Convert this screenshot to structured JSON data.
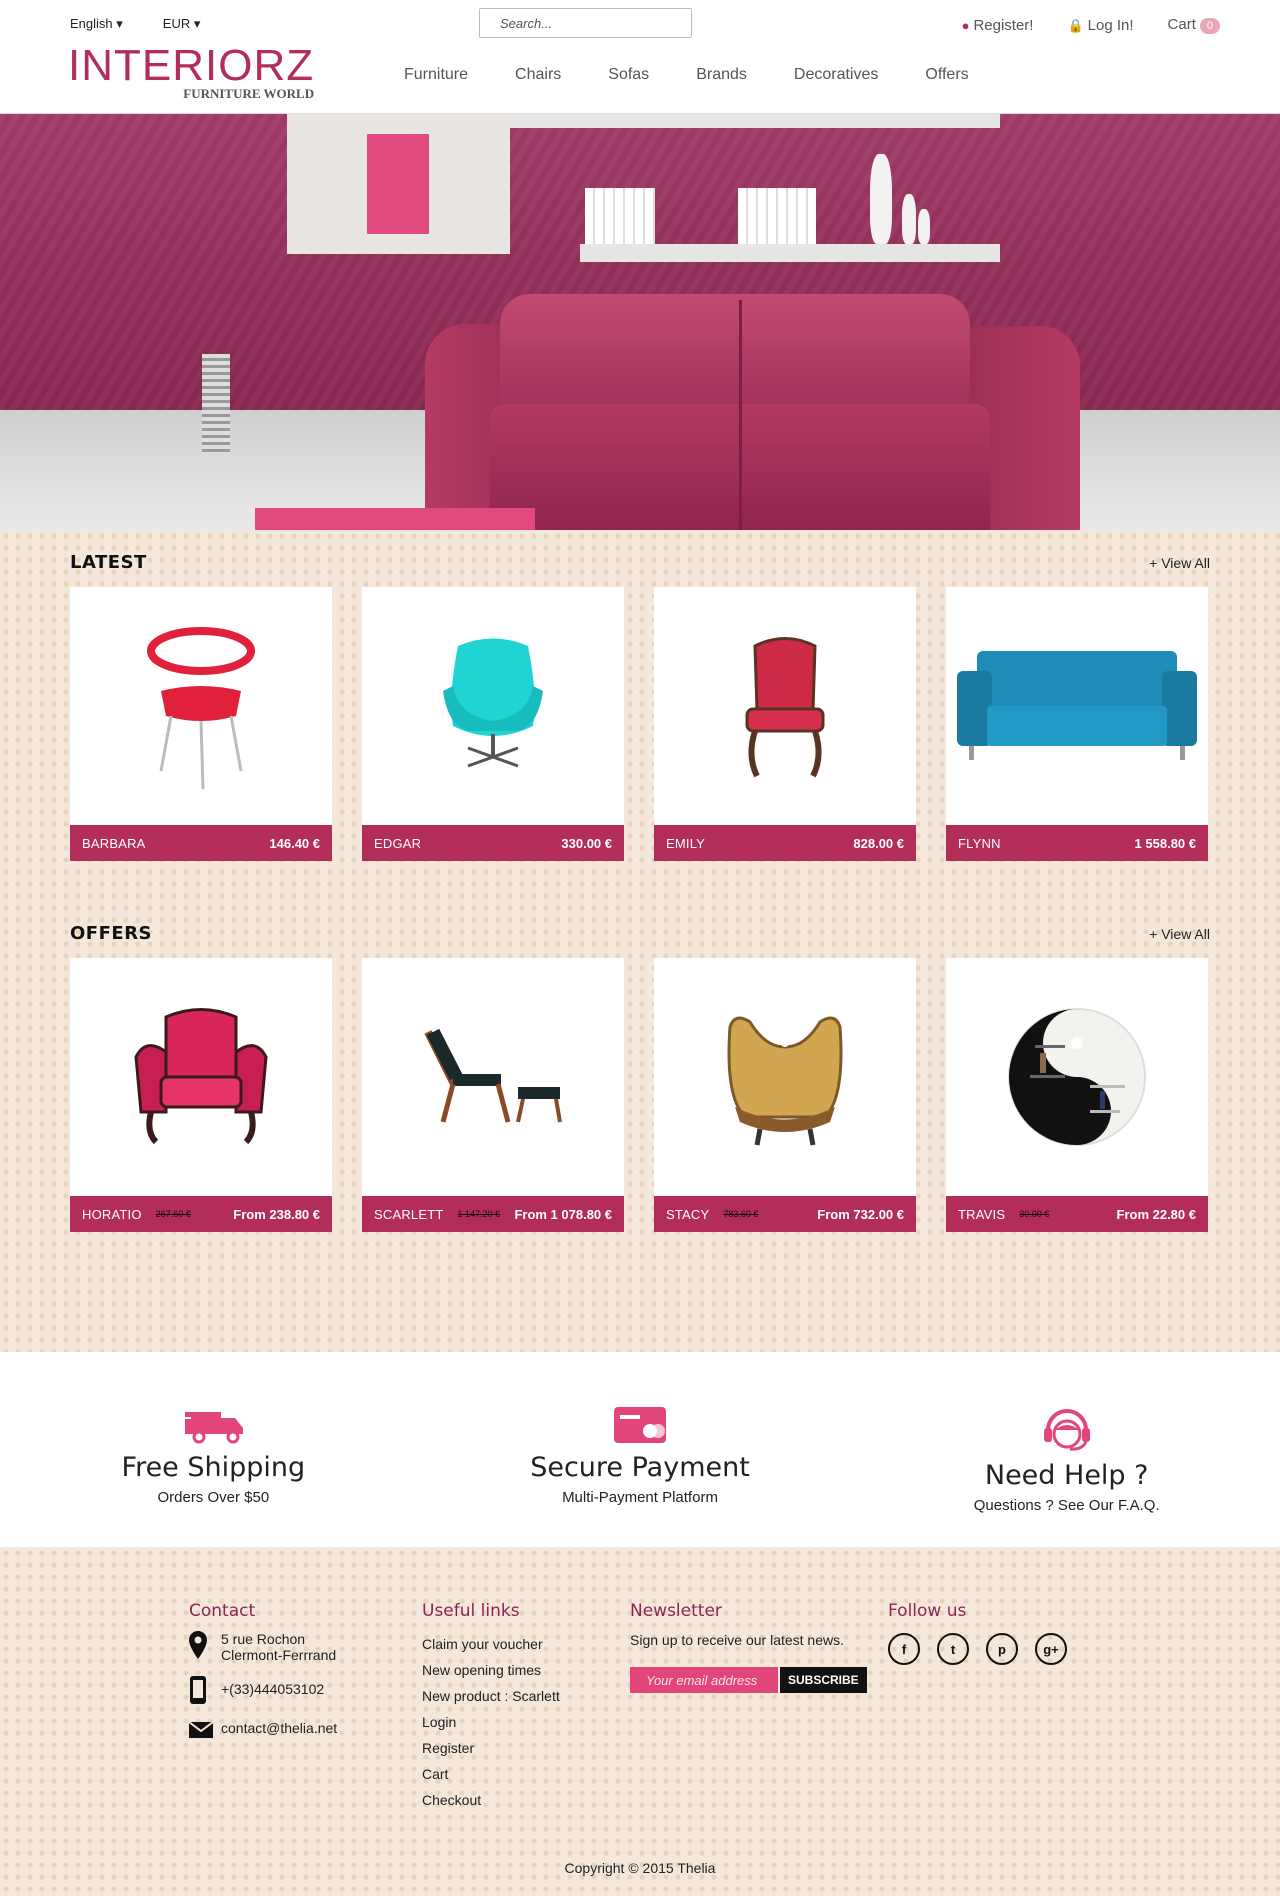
{
  "topbar": {
    "language": "English",
    "currency": "EUR",
    "search_placeholder": "Search...",
    "register": "Register!",
    "login": "Log In!",
    "cart": "Cart",
    "cart_count": "0"
  },
  "logo": {
    "name": "INTERIORZ",
    "tagline": "FURNITURE WORLD"
  },
  "nav": [
    "Furniture",
    "Chairs",
    "Sofas",
    "Brands",
    "Decoratives",
    "Offers"
  ],
  "latest": {
    "title": "LATEST",
    "view_all": "+ View All",
    "items": [
      {
        "name": "BARBARA",
        "price": "146.40 €"
      },
      {
        "name": "EDGAR",
        "price": "330.00 €"
      },
      {
        "name": "EMILY",
        "price": "828.00 €"
      },
      {
        "name": "FLYNN",
        "price": "1 558.80 €"
      }
    ]
  },
  "offers": {
    "title": "OFFERS",
    "view_all": "+ View All",
    "items": [
      {
        "name": "HORATIO",
        "old_price": "267.60 €",
        "price": "From 238.80 €"
      },
      {
        "name": "SCARLETT",
        "old_price": "1 147.20 €",
        "price": "From 1 078.80 €"
      },
      {
        "name": "STACY",
        "old_price": "783.60 €",
        "price": "From 732.00 €"
      },
      {
        "name": "TRAVIS",
        "old_price": "30.00 €",
        "price": "From 22.80 €"
      }
    ]
  },
  "features": [
    {
      "title": "Free Shipping",
      "subtitle": "Orders Over $50",
      "icon": "truck-icon"
    },
    {
      "title": "Secure Payment",
      "subtitle": "Multi-Payment Platform",
      "icon": "credit-card-icon"
    },
    {
      "title": "Need Help ?",
      "subtitle": "Questions ? See Our F.A.Q.",
      "icon": "headset-icon"
    }
  ],
  "footer": {
    "contact": {
      "title": "Contact",
      "address_line1": "5 rue Rochon",
      "address_line2": "Clermont-Ferrrand",
      "phone": "+(33)444053102",
      "email": "contact@thelia.net"
    },
    "links": {
      "title": "Useful links",
      "items": [
        "Claim your voucher",
        "New opening times",
        "New product : Scarlett",
        "Login",
        "Register",
        "Cart",
        "Checkout"
      ]
    },
    "newsletter": {
      "title": "Newsletter",
      "text": "Sign up to receive our latest news.",
      "placeholder": "Your email address",
      "button": "SUBSCRIBE"
    },
    "follow": {
      "title": "Follow us",
      "networks": [
        "f",
        "t",
        "p",
        "g+"
      ]
    },
    "copyright": "Copyright © 2015 Thelia"
  },
  "colors": {
    "brand": "#b22d58",
    "accent": "#e2457a",
    "background": "#f5e8da"
  }
}
